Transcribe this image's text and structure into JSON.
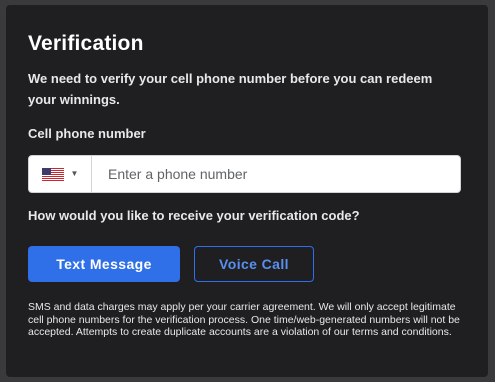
{
  "title": "Verification",
  "intro": "We need to verify your cell phone number before you can redeem your winnings.",
  "phone": {
    "label": "Cell phone number",
    "country_flag_icon": "us-flag-icon",
    "placeholder": "Enter a phone number",
    "value": ""
  },
  "question": "How would you like to receive your verification code?",
  "buttons": {
    "text_message": "Text Message",
    "voice_call": "Voice Call"
  },
  "disclaimer": "SMS and data charges may apply per your carrier agreement. We will only accept legitimate cell phone numbers for the verification process. One time/web-generated numbers will not be accepted. Attempts to create duplicate accounts are a violation of our terms and conditions.",
  "colors": {
    "background": "#3a3a3c",
    "panel": "#1f1f22",
    "accent": "#2f6fe8",
    "text": "#e8e8ea"
  }
}
